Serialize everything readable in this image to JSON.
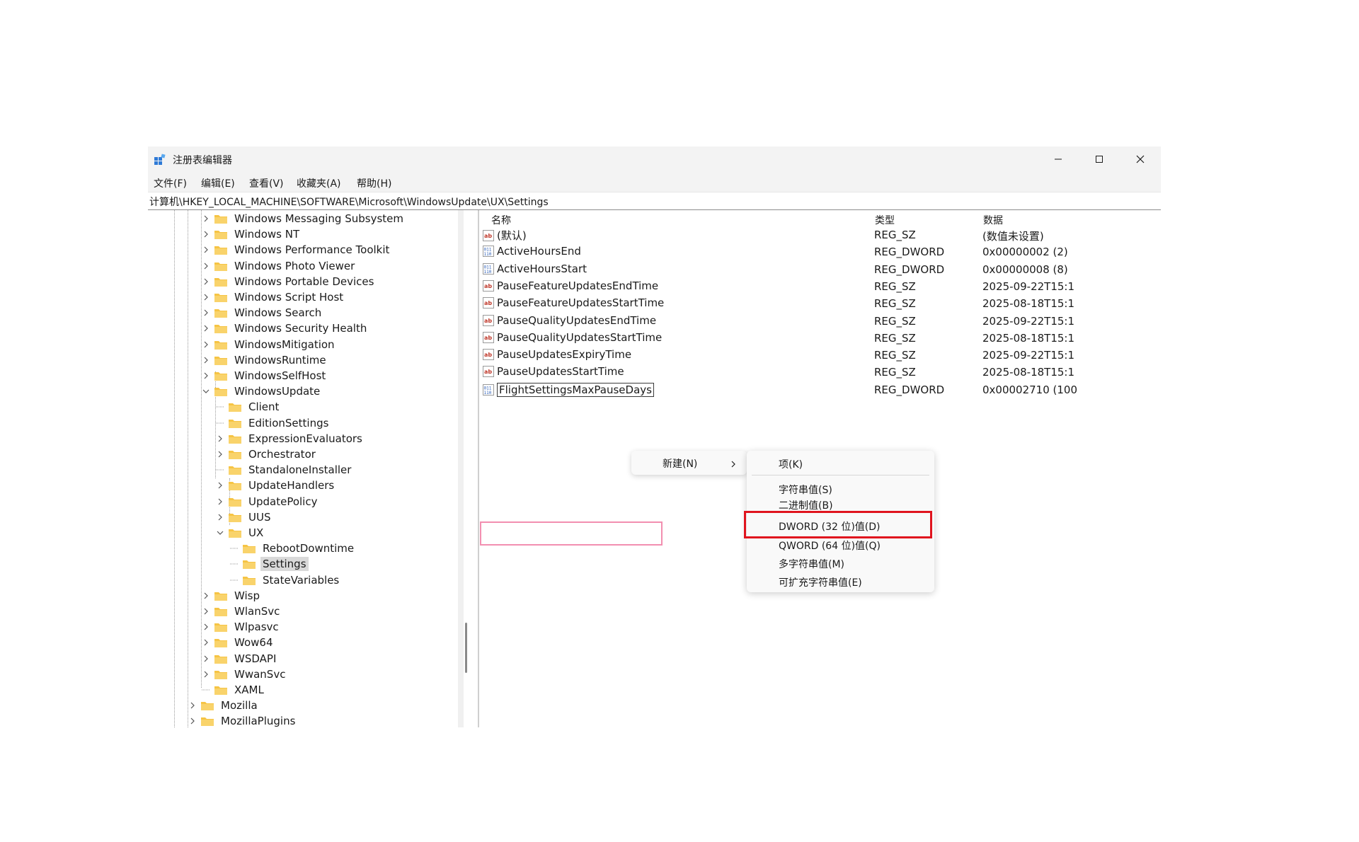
{
  "window": {
    "title": "注册表编辑器",
    "controls": [
      "minimize",
      "maximize",
      "close"
    ]
  },
  "menu": [
    "文件(F)",
    "编辑(E)",
    "查看(V)",
    "收藏夹(A)",
    "帮助(H)"
  ],
  "address": "计算机\\HKEY_LOCAL_MACHINE\\SOFTWARE\\Microsoft\\WindowsUpdate\\UX\\Settings",
  "tree": [
    {
      "label": "Windows Messaging Subsystem",
      "expander": "collapsed",
      "level": 0
    },
    {
      "label": "Windows NT",
      "expander": "collapsed",
      "level": 0
    },
    {
      "label": "Windows Performance Toolkit",
      "expander": "collapsed",
      "level": 0
    },
    {
      "label": "Windows Photo Viewer",
      "expander": "collapsed",
      "level": 0
    },
    {
      "label": "Windows Portable Devices",
      "expander": "collapsed",
      "level": 0
    },
    {
      "label": "Windows Script Host",
      "expander": "collapsed",
      "level": 0
    },
    {
      "label": "Windows Search",
      "expander": "collapsed",
      "level": 0
    },
    {
      "label": "Windows Security Health",
      "expander": "collapsed",
      "level": 0
    },
    {
      "label": "WindowsMitigation",
      "expander": "collapsed",
      "level": 0
    },
    {
      "label": "WindowsRuntime",
      "expander": "collapsed",
      "level": 0
    },
    {
      "label": "WindowsSelfHost",
      "expander": "collapsed",
      "level": 0
    },
    {
      "label": "WindowsUpdate",
      "expander": "expanded",
      "level": 0
    },
    {
      "label": "Client",
      "expander": "none",
      "level": 1
    },
    {
      "label": "EditionSettings",
      "expander": "none",
      "level": 1
    },
    {
      "label": "ExpressionEvaluators",
      "expander": "collapsed",
      "level": 1
    },
    {
      "label": "Orchestrator",
      "expander": "collapsed",
      "level": 1
    },
    {
      "label": "StandaloneInstaller",
      "expander": "none",
      "level": 1
    },
    {
      "label": "UpdateHandlers",
      "expander": "collapsed",
      "level": 1
    },
    {
      "label": "UpdatePolicy",
      "expander": "collapsed",
      "level": 1
    },
    {
      "label": "UUS",
      "expander": "collapsed",
      "level": 1
    },
    {
      "label": "UX",
      "expander": "expanded",
      "level": 1
    },
    {
      "label": "RebootDowntime",
      "expander": "none",
      "level": 2
    },
    {
      "label": "Settings",
      "expander": "none",
      "level": 2,
      "selected": true
    },
    {
      "label": "StateVariables",
      "expander": "none",
      "level": 2
    },
    {
      "label": "Wisp",
      "expander": "collapsed",
      "level": 0
    },
    {
      "label": "WlanSvc",
      "expander": "collapsed",
      "level": 0
    },
    {
      "label": "Wlpasvc",
      "expander": "collapsed",
      "level": 0
    },
    {
      "label": "Wow64",
      "expander": "collapsed",
      "level": 0
    },
    {
      "label": "WSDAPI",
      "expander": "collapsed",
      "level": 0
    },
    {
      "label": "WwanSvc",
      "expander": "collapsed",
      "level": 0
    },
    {
      "label": "XAML",
      "expander": "none",
      "level": 0
    },
    {
      "label": "Mozilla",
      "expander": "collapsed",
      "level": -1
    },
    {
      "label": "MozillaPlugins",
      "expander": "collapsed",
      "level": -1
    }
  ],
  "list": {
    "headers": {
      "name": "名称",
      "type": "类型",
      "data": "数据"
    },
    "rows": [
      {
        "icon": "string-value-icon",
        "name": "(默认)",
        "type": "REG_SZ",
        "data": "(数值未设置)"
      },
      {
        "icon": "dword-value-icon",
        "name": "ActiveHoursEnd",
        "type": "REG_DWORD",
        "data": "0x00000002 (2)"
      },
      {
        "icon": "dword-value-icon",
        "name": "ActiveHoursStart",
        "type": "REG_DWORD",
        "data": "0x00000008 (8)"
      },
      {
        "icon": "string-value-icon",
        "name": "PauseFeatureUpdatesEndTime",
        "type": "REG_SZ",
        "data": "2025-09-22T15:1"
      },
      {
        "icon": "string-value-icon",
        "name": "PauseFeatureUpdatesStartTime",
        "type": "REG_SZ",
        "data": "2025-08-18T15:1"
      },
      {
        "icon": "string-value-icon",
        "name": "PauseQualityUpdatesEndTime",
        "type": "REG_SZ",
        "data": "2025-09-22T15:1"
      },
      {
        "icon": "string-value-icon",
        "name": "PauseQualityUpdatesStartTime",
        "type": "REG_SZ",
        "data": "2025-08-18T15:1"
      },
      {
        "icon": "string-value-icon",
        "name": "PauseUpdatesExpiryTime",
        "type": "REG_SZ",
        "data": "2025-09-22T15:1"
      },
      {
        "icon": "string-value-icon",
        "name": "PauseUpdatesStartTime",
        "type": "REG_SZ",
        "data": "2025-08-18T15:1"
      },
      {
        "icon": "dword-value-icon",
        "name": "FlightSettingsMaxPauseDays",
        "type": "REG_DWORD",
        "data": "0x00002710 (100",
        "editing": true
      }
    ]
  },
  "context_menu": {
    "new_label": "新建(N)",
    "submenu": [
      "项(K)",
      "字符串值(S)",
      "二进制值(B)",
      "DWORD (32 位)值(D)",
      "QWORD (64 位)值(Q)",
      "多字符串值(M)",
      "可扩充字符串值(E)"
    ],
    "highlighted": "DWORD (32 位)值(D)"
  },
  "colors": {
    "titlebar_bg": "#f3f3f3",
    "folder_yellow": "#f6c444",
    "highlight_box": "#e0141e",
    "edit_highlight": "#f28fb0"
  }
}
